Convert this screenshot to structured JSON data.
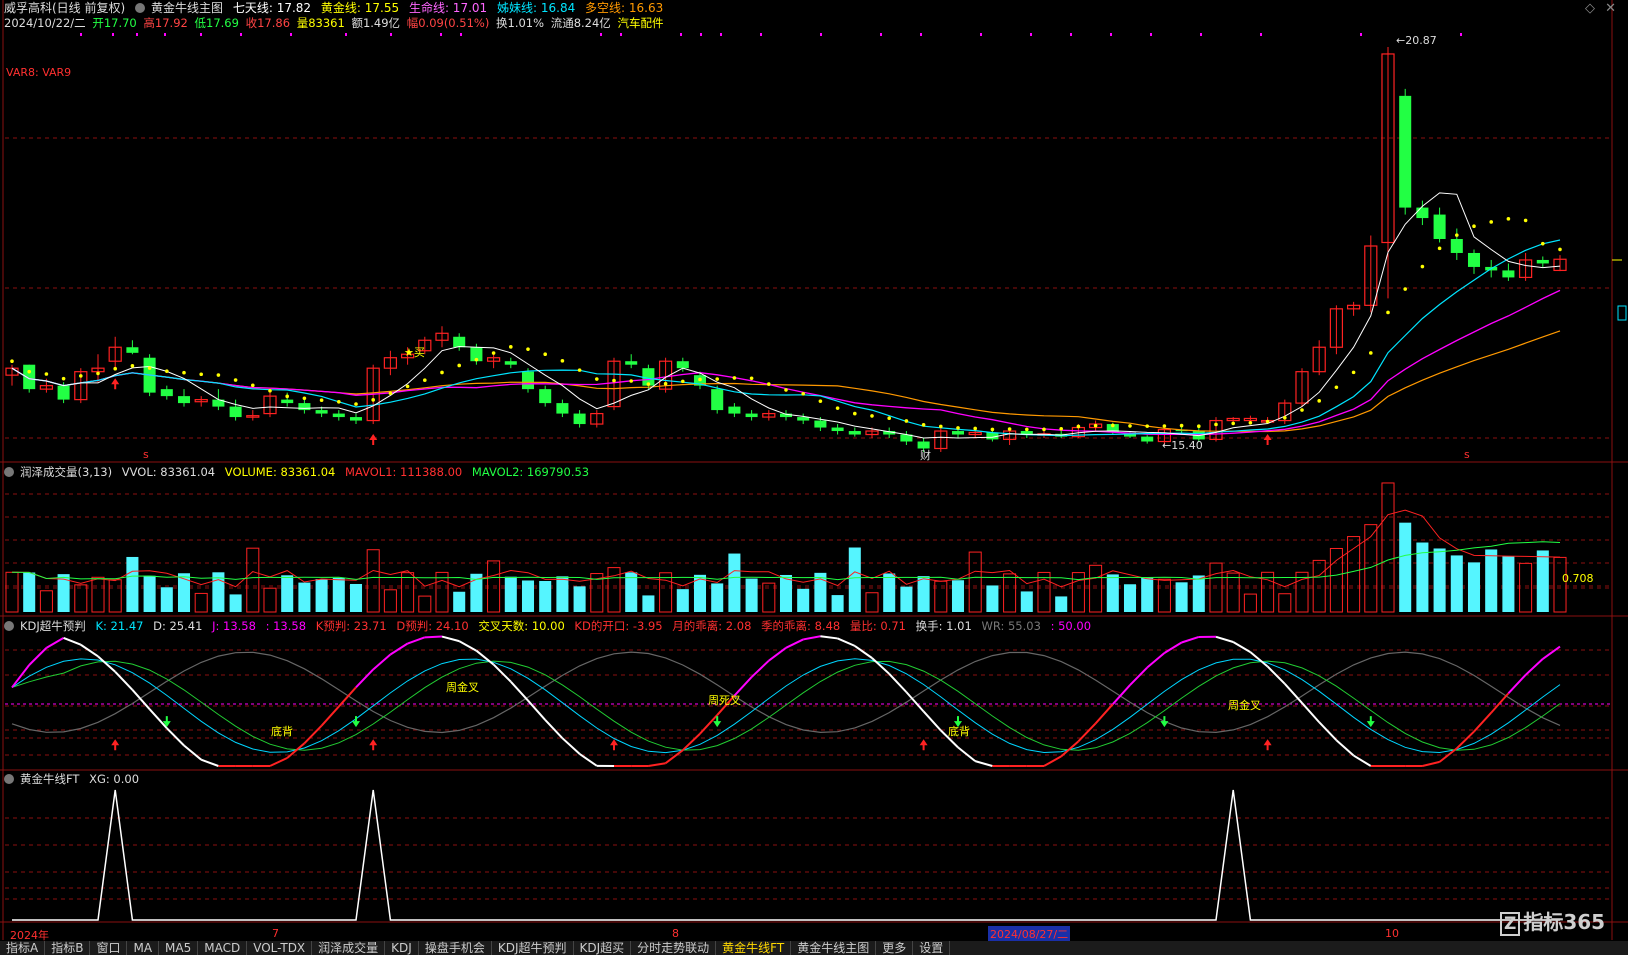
{
  "stock": {
    "name": "威孚高科(日线 前复权)",
    "indicator": "黄金牛线主图",
    "ma7_label": "七天线: 17.82",
    "gold_label": "黄金线: 17.55",
    "life_label": "生命线: 17.01",
    "sister_label": "姊妹线: 16.84",
    "bull_label": "多空线: 16.63"
  },
  "quote": {
    "date": "2024/10/22/二",
    "open": "开17.70",
    "high": "高17.92",
    "low": "低17.69",
    "close": "收17.86",
    "vol": "量83361",
    "amount": "额1.49亿",
    "change": "幅0.09(0.51%)",
    "turnover": "换1.01%",
    "float": "流通8.24亿",
    "sector": "汽车配件"
  },
  "var_label": "VAR8: VAR9",
  "price_labels": {
    "high": "20.87",
    "low": "15.40",
    "buy": "买",
    "cai": "财",
    "s_mark": "s"
  },
  "vol_panel": {
    "title": "润泽成交量(3,13)",
    "vvol": "VVOL: 83361.04",
    "volume": "VOLUME: 83361.04",
    "mavol1": "MAVOL1: 111388.00",
    "mavol2": "MAVOL2: 169790.53",
    "right_value": "0.708"
  },
  "kdj_panel": {
    "title": "KDJ超牛预判",
    "k": "K: 21.47",
    "d": "D: 25.41",
    "j": "J: 13.58",
    "j2": ": 13.58",
    "kpred": "K预判: 23.71",
    "dpred": "D预判: 24.10",
    "cross_days": "交叉天数: 10.00",
    "kd_open": "KD的开口: -3.95",
    "month_dev": "月的乖离: 2.08",
    "season_dev": "季的乖离: 8.48",
    "vol_ratio": "量比: 0.71",
    "turnover": "换手: 1.01",
    "wr": "WR: 55.03",
    "extra": ": 50.00",
    "annotations": [
      "周金叉",
      "周死叉",
      "底背",
      "底背",
      "周金叉"
    ]
  },
  "ft_panel": {
    "title": "黄金牛线FT",
    "xg": "XG: 0.00"
  },
  "time_axis": {
    "year": "2024年",
    "m7": "7",
    "m8": "8",
    "cursor_date": "2024/08/27/二",
    "m10": "10"
  },
  "tabs": [
    "指标A",
    "指标B",
    "窗口",
    "MA",
    "MA5",
    "MACD",
    "VOL-TDX",
    "润泽成交量",
    "KDJ",
    "操盘手机会",
    "KDJ超牛预判",
    "KDJ超买",
    "分时走势联动",
    "黄金牛线FT",
    "黄金牛线主图",
    "更多",
    "设置"
  ],
  "active_tab_index": 13,
  "brand": "指标365",
  "colors": {
    "up": "#ff2222",
    "down": "#22ff44",
    "grid": "#8a1010",
    "ma7": "#ffffff",
    "gold_dot": "#ffff00",
    "life": "#00e5ff",
    "sister": "#ff00ff",
    "bull": "#ff9900",
    "vol_bar": "#55f5ff"
  },
  "chart_data": {
    "type": "candlestick",
    "series": [
      {
        "name": "price",
        "ohlc": [
          [
            16.2,
            16.35,
            16.05,
            16.3
          ],
          [
            16.35,
            16.35,
            15.95,
            16.0
          ],
          [
            16.0,
            16.15,
            15.95,
            16.05
          ],
          [
            16.05,
            16.1,
            15.8,
            15.85
          ],
          [
            15.85,
            16.3,
            15.8,
            16.25
          ],
          [
            16.25,
            16.5,
            16.1,
            16.3
          ],
          [
            16.4,
            16.75,
            16.3,
            16.6
          ],
          [
            16.6,
            16.7,
            16.5,
            16.52
          ],
          [
            16.45,
            16.5,
            15.9,
            15.95
          ],
          [
            16.0,
            16.05,
            15.85,
            15.9
          ],
          [
            15.9,
            16.0,
            15.75,
            15.8
          ],
          [
            15.82,
            15.9,
            15.75,
            15.85
          ],
          [
            15.85,
            16.0,
            15.7,
            15.75
          ],
          [
            15.75,
            15.85,
            15.55,
            15.6
          ],
          [
            15.6,
            15.7,
            15.55,
            15.62
          ],
          [
            15.65,
            15.95,
            15.6,
            15.9
          ],
          [
            15.85,
            15.95,
            15.75,
            15.8
          ],
          [
            15.8,
            15.85,
            15.65,
            15.7
          ],
          [
            15.7,
            15.75,
            15.6,
            15.65
          ],
          [
            15.65,
            15.7,
            15.55,
            15.6
          ],
          [
            15.6,
            15.65,
            15.5,
            15.55
          ],
          [
            15.55,
            16.35,
            15.5,
            16.3
          ],
          [
            16.3,
            16.55,
            16.2,
            16.45
          ],
          [
            16.45,
            16.6,
            16.35,
            16.5
          ],
          [
            16.55,
            16.75,
            16.5,
            16.7
          ],
          [
            16.7,
            16.9,
            16.6,
            16.8
          ],
          [
            16.75,
            16.8,
            16.55,
            16.6
          ],
          [
            16.6,
            16.65,
            16.35,
            16.4
          ],
          [
            16.4,
            16.5,
            16.3,
            16.45
          ],
          [
            16.4,
            16.45,
            16.3,
            16.35
          ],
          [
            16.25,
            16.3,
            15.95,
            16.0
          ],
          [
            16.0,
            16.05,
            15.75,
            15.8
          ],
          [
            15.8,
            15.85,
            15.6,
            15.65
          ],
          [
            15.65,
            15.7,
            15.45,
            15.5
          ],
          [
            15.5,
            15.7,
            15.45,
            15.65
          ],
          [
            15.75,
            16.45,
            15.7,
            16.4
          ],
          [
            16.4,
            16.5,
            16.3,
            16.35
          ],
          [
            16.3,
            16.35,
            16.0,
            16.05
          ],
          [
            16.0,
            16.45,
            15.95,
            16.4
          ],
          [
            16.4,
            16.45,
            16.25,
            16.3
          ],
          [
            16.2,
            16.25,
            16.0,
            16.05
          ],
          [
            16.0,
            16.05,
            15.65,
            15.7
          ],
          [
            15.75,
            15.8,
            15.6,
            15.65
          ],
          [
            15.65,
            15.7,
            15.55,
            15.6
          ],
          [
            15.6,
            15.7,
            15.55,
            15.65
          ],
          [
            15.65,
            15.7,
            15.55,
            15.6
          ],
          [
            15.6,
            15.65,
            15.5,
            15.55
          ],
          [
            15.55,
            15.6,
            15.4,
            15.45
          ],
          [
            15.45,
            15.5,
            15.35,
            15.4
          ],
          [
            15.4,
            15.45,
            15.32,
            15.35
          ],
          [
            15.35,
            15.45,
            15.3,
            15.4
          ],
          [
            15.4,
            15.45,
            15.3,
            15.35
          ],
          [
            15.35,
            15.4,
            15.2,
            15.25
          ],
          [
            15.25,
            15.3,
            15.1,
            15.15
          ],
          [
            15.15,
            15.45,
            15.1,
            15.4
          ],
          [
            15.4,
            15.45,
            15.3,
            15.35
          ],
          [
            15.35,
            15.42,
            15.3,
            15.38
          ],
          [
            15.38,
            15.4,
            15.25,
            15.28
          ],
          [
            15.28,
            15.45,
            15.2,
            15.4
          ],
          [
            15.4,
            15.45,
            15.3,
            15.35
          ],
          [
            15.35,
            15.4,
            15.3,
            15.36
          ],
          [
            15.36,
            15.4,
            15.3,
            15.32
          ],
          [
            15.32,
            15.5,
            15.3,
            15.45
          ],
          [
            15.45,
            15.55,
            15.4,
            15.5
          ],
          [
            15.5,
            15.52,
            15.35,
            15.38
          ],
          [
            15.38,
            15.4,
            15.3,
            15.32
          ],
          [
            15.32,
            15.34,
            15.22,
            15.25
          ],
          [
            15.25,
            15.45,
            15.2,
            15.42
          ],
          [
            15.42,
            15.48,
            15.35,
            15.4
          ],
          [
            15.4,
            15.45,
            15.25,
            15.28
          ],
          [
            15.28,
            15.6,
            15.25,
            15.55
          ],
          [
            15.55,
            15.6,
            15.5,
            15.58
          ],
          [
            15.55,
            15.62,
            15.5,
            15.58
          ],
          [
            15.55,
            15.6,
            15.5,
            15.55
          ],
          [
            15.55,
            15.85,
            15.5,
            15.8
          ],
          [
            15.8,
            16.3,
            15.75,
            16.25
          ],
          [
            16.25,
            16.7,
            16.2,
            16.6
          ],
          [
            16.6,
            17.2,
            16.5,
            17.15
          ],
          [
            17.15,
            17.25,
            17.05,
            17.2
          ],
          [
            17.2,
            18.2,
            17.1,
            18.05
          ],
          [
            18.1,
            20.9,
            17.3,
            20.8
          ],
          [
            20.2,
            20.3,
            18.5,
            18.6
          ],
          [
            18.6,
            18.7,
            18.35,
            18.45
          ],
          [
            18.5,
            18.6,
            18.1,
            18.15
          ],
          [
            18.15,
            18.3,
            17.85,
            17.95
          ],
          [
            17.95,
            18.0,
            17.65,
            17.75
          ],
          [
            17.75,
            17.85,
            17.6,
            17.7
          ],
          [
            17.7,
            17.8,
            17.55,
            17.6
          ],
          [
            17.6,
            17.95,
            17.55,
            17.85
          ],
          [
            17.85,
            17.9,
            17.75,
            17.8
          ],
          [
            17.7,
            17.92,
            17.69,
            17.86
          ]
        ]
      },
      {
        "name": "七天线",
        "color": "#ffffff"
      },
      {
        "name": "黄金线",
        "color": "#ffff00"
      },
      {
        "name": "生命线",
        "color": "#00e5ff"
      },
      {
        "name": "姊妹线",
        "color": "#ff00ff"
      },
      {
        "name": "多空线",
        "color": "#ff9900"
      }
    ],
    "price_range": [
      15.2,
      21.0
    ],
    "extremes": {
      "high": 20.87,
      "low": 15.4
    }
  }
}
